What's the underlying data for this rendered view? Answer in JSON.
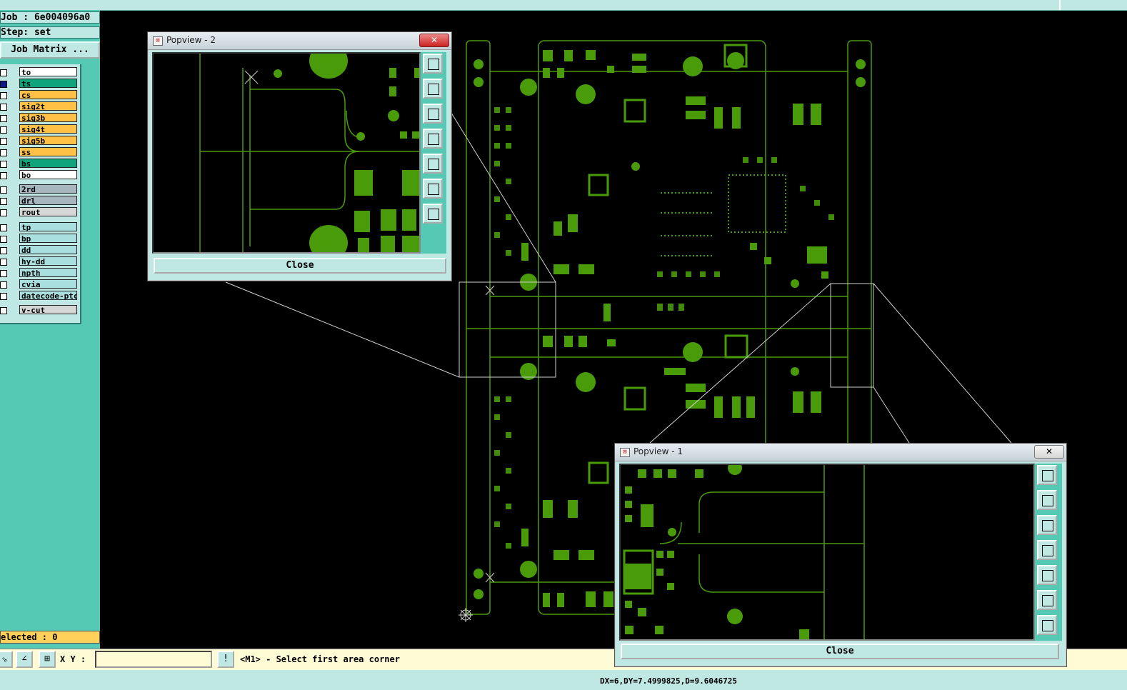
{
  "job": {
    "line1": "Job : 6e004096a0",
    "line2": "Step: set",
    "matrix_button": "Job Matrix ..."
  },
  "layers": [
    {
      "name": "to",
      "color": "#ffffff"
    },
    {
      "name": "ts",
      "color": "#0fa37c"
    },
    {
      "name": "cs",
      "color": "#ffc247"
    },
    {
      "name": "sig2t",
      "color": "#ffc247"
    },
    {
      "name": "sig3b",
      "color": "#ffc247"
    },
    {
      "name": "sig4t",
      "color": "#ffc247"
    },
    {
      "name": "sig5b",
      "color": "#ffc247"
    },
    {
      "name": "ss",
      "color": "#ffc247"
    },
    {
      "name": "bs",
      "color": "#0fa37c"
    },
    {
      "name": "bo",
      "color": "#ffffff"
    },
    {
      "name": "2rd",
      "color": "#a7b7bd"
    },
    {
      "name": "drl",
      "color": "#a7b7bd"
    },
    {
      "name": "rout",
      "color": "#d6d6d6"
    },
    {
      "name": "tp",
      "color": "#a9e0df"
    },
    {
      "name": "bp",
      "color": "#a9e0df"
    },
    {
      "name": "dd",
      "color": "#a9e0df"
    },
    {
      "name": "hy-dd",
      "color": "#a9e0df"
    },
    {
      "name": "npth",
      "color": "#a9e0df"
    },
    {
      "name": "cvia",
      "color": "#a9e0df"
    },
    {
      "name": "datecode-ptc",
      "color": "#a9e0df"
    },
    {
      "name": "v-cut",
      "color": "#d6d6d6"
    }
  ],
  "selected": "elected : 0",
  "status": {
    "xy_label": "X Y :",
    "xy_value": "",
    "message": "<M1> - Select first area corner",
    "measure": "DX=6,DY=7.4999825,D=9.6046725"
  },
  "popview2": {
    "title": "Popview - 2",
    "close_x": "✕",
    "close_button": "Close"
  },
  "popview1": {
    "title": "Popview - 1",
    "close_x": "✕",
    "close_button": "Close"
  },
  "colors": {
    "pcb_green": "#4a9b0a",
    "panel_teal": "#56c9b4",
    "panel_light": "#bfe7e3"
  }
}
